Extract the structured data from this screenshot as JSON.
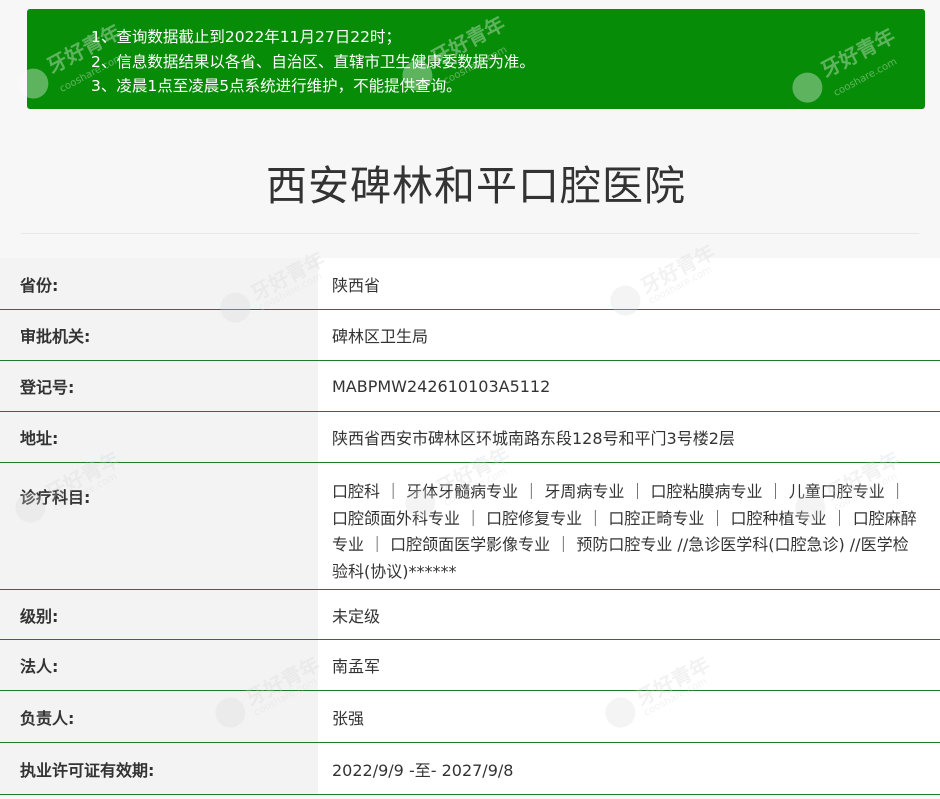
{
  "notice": {
    "lines": [
      "1、查询数据截止到2022年11月27日22时；",
      "2、信息数据结果以各省、自治区、直辖市卫生健康委数据为准。",
      "3、凌晨1点至凌晨5点系统进行维护，不能提供查询。"
    ],
    "background_color": "#078c07"
  },
  "watermark": {
    "text": "牙好青年",
    "subtext": "cooshare.com"
  },
  "hospital": {
    "name": "西安碑林和平口腔医院"
  },
  "details": [
    {
      "label": "省份:",
      "value": "陕西省"
    },
    {
      "label": "审批机关:",
      "value": "碑林区卫生局"
    },
    {
      "label": "登记号:",
      "value": "MABPMW242610103A5112"
    },
    {
      "label": "地址:",
      "value": "陕西省西安市碑林区环城南路东段128号和平门3号楼2层"
    },
    {
      "label": "诊疗科目:",
      "value": "口腔科 ｜ 牙体牙髓病专业 ｜ 牙周病专业 ｜ 口腔粘膜病专业 ｜ 儿童口腔专业 ｜ 口腔颌面外科专业 ｜ 口腔修复专业 ｜ 口腔正畸专业 ｜ 口腔种植专业 ｜ 口腔麻醉专业 ｜ 口腔颌面医学影像专业 ｜ 预防口腔专业 //急诊医学科(口腔急诊) //医学检验科(协议)******"
    },
    {
      "label": "级别:",
      "value": "未定级"
    },
    {
      "label": "法人:",
      "value": "南孟军"
    },
    {
      "label": "负责人:",
      "value": "张强"
    },
    {
      "label": "执业许可证有效期:",
      "value": "2022/9/9 -至- 2027/9/8"
    }
  ],
  "colors": {
    "row_divider": "#1f7a2e",
    "label_background": "#f3f3f3",
    "value_background": "#ffffff"
  }
}
